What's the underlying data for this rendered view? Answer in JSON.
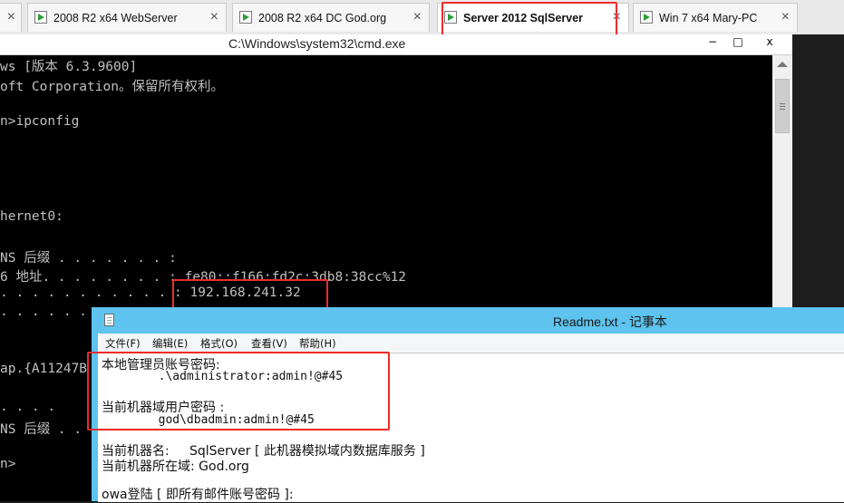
{
  "tabs": [
    {
      "label": "2008 R2 x64 WebServer",
      "active": false
    },
    {
      "label": "2008 R2 x64 DC God.org",
      "active": false
    },
    {
      "label": "Server 2012 SqlServer",
      "active": true
    },
    {
      "label": "Win 7 x64 Mary-PC",
      "active": false
    }
  ],
  "tab_close_glyph": "×",
  "cmd": {
    "title": "C:\\Windows\\system32\\cmd.exe",
    "minimize": "−",
    "maximize": "□",
    "close": "x",
    "lines": [
      "ws [版本 6.3.9600]",
      "oft Corporation。保留所有权利。",
      "n>ipconfig",
      "hernet0:",
      "NS 后缀 . . . . . . . :",
      "6 地址. . . . . . . . : fe80::f166:fd2c:3db8:38cc%12",
      ". . . . . . . . . . . : 192.168.241.32",
      ". . . . . .",
      "ap.{A11247B",
      ". . . .",
      "NS 后缀 . .",
      "n>"
    ]
  },
  "notepad": {
    "title": "Readme.txt - 记事本",
    "menu": [
      "文件(F)",
      "编辑(E)",
      "格式(O)",
      "查看(V)",
      "帮助(H)"
    ],
    "lines": [
      "本地管理员账号密码:",
      "        .\\administrator:admin!@#45",
      "当前机器域用户密码 :",
      "        god\\dbadmin:admin!@#45",
      "当前机器名:     SqlServer [ 此机器模拟域内数据库服务 ]",
      "当前机器所在域: God.org",
      "owa登陆 [ 即所有邮件账号密码 ]:"
    ]
  },
  "colors": {
    "highlight": "#ee2b2b",
    "notepad_frame": "#5ec3ee",
    "cmd_text": "#c0c0c0"
  }
}
